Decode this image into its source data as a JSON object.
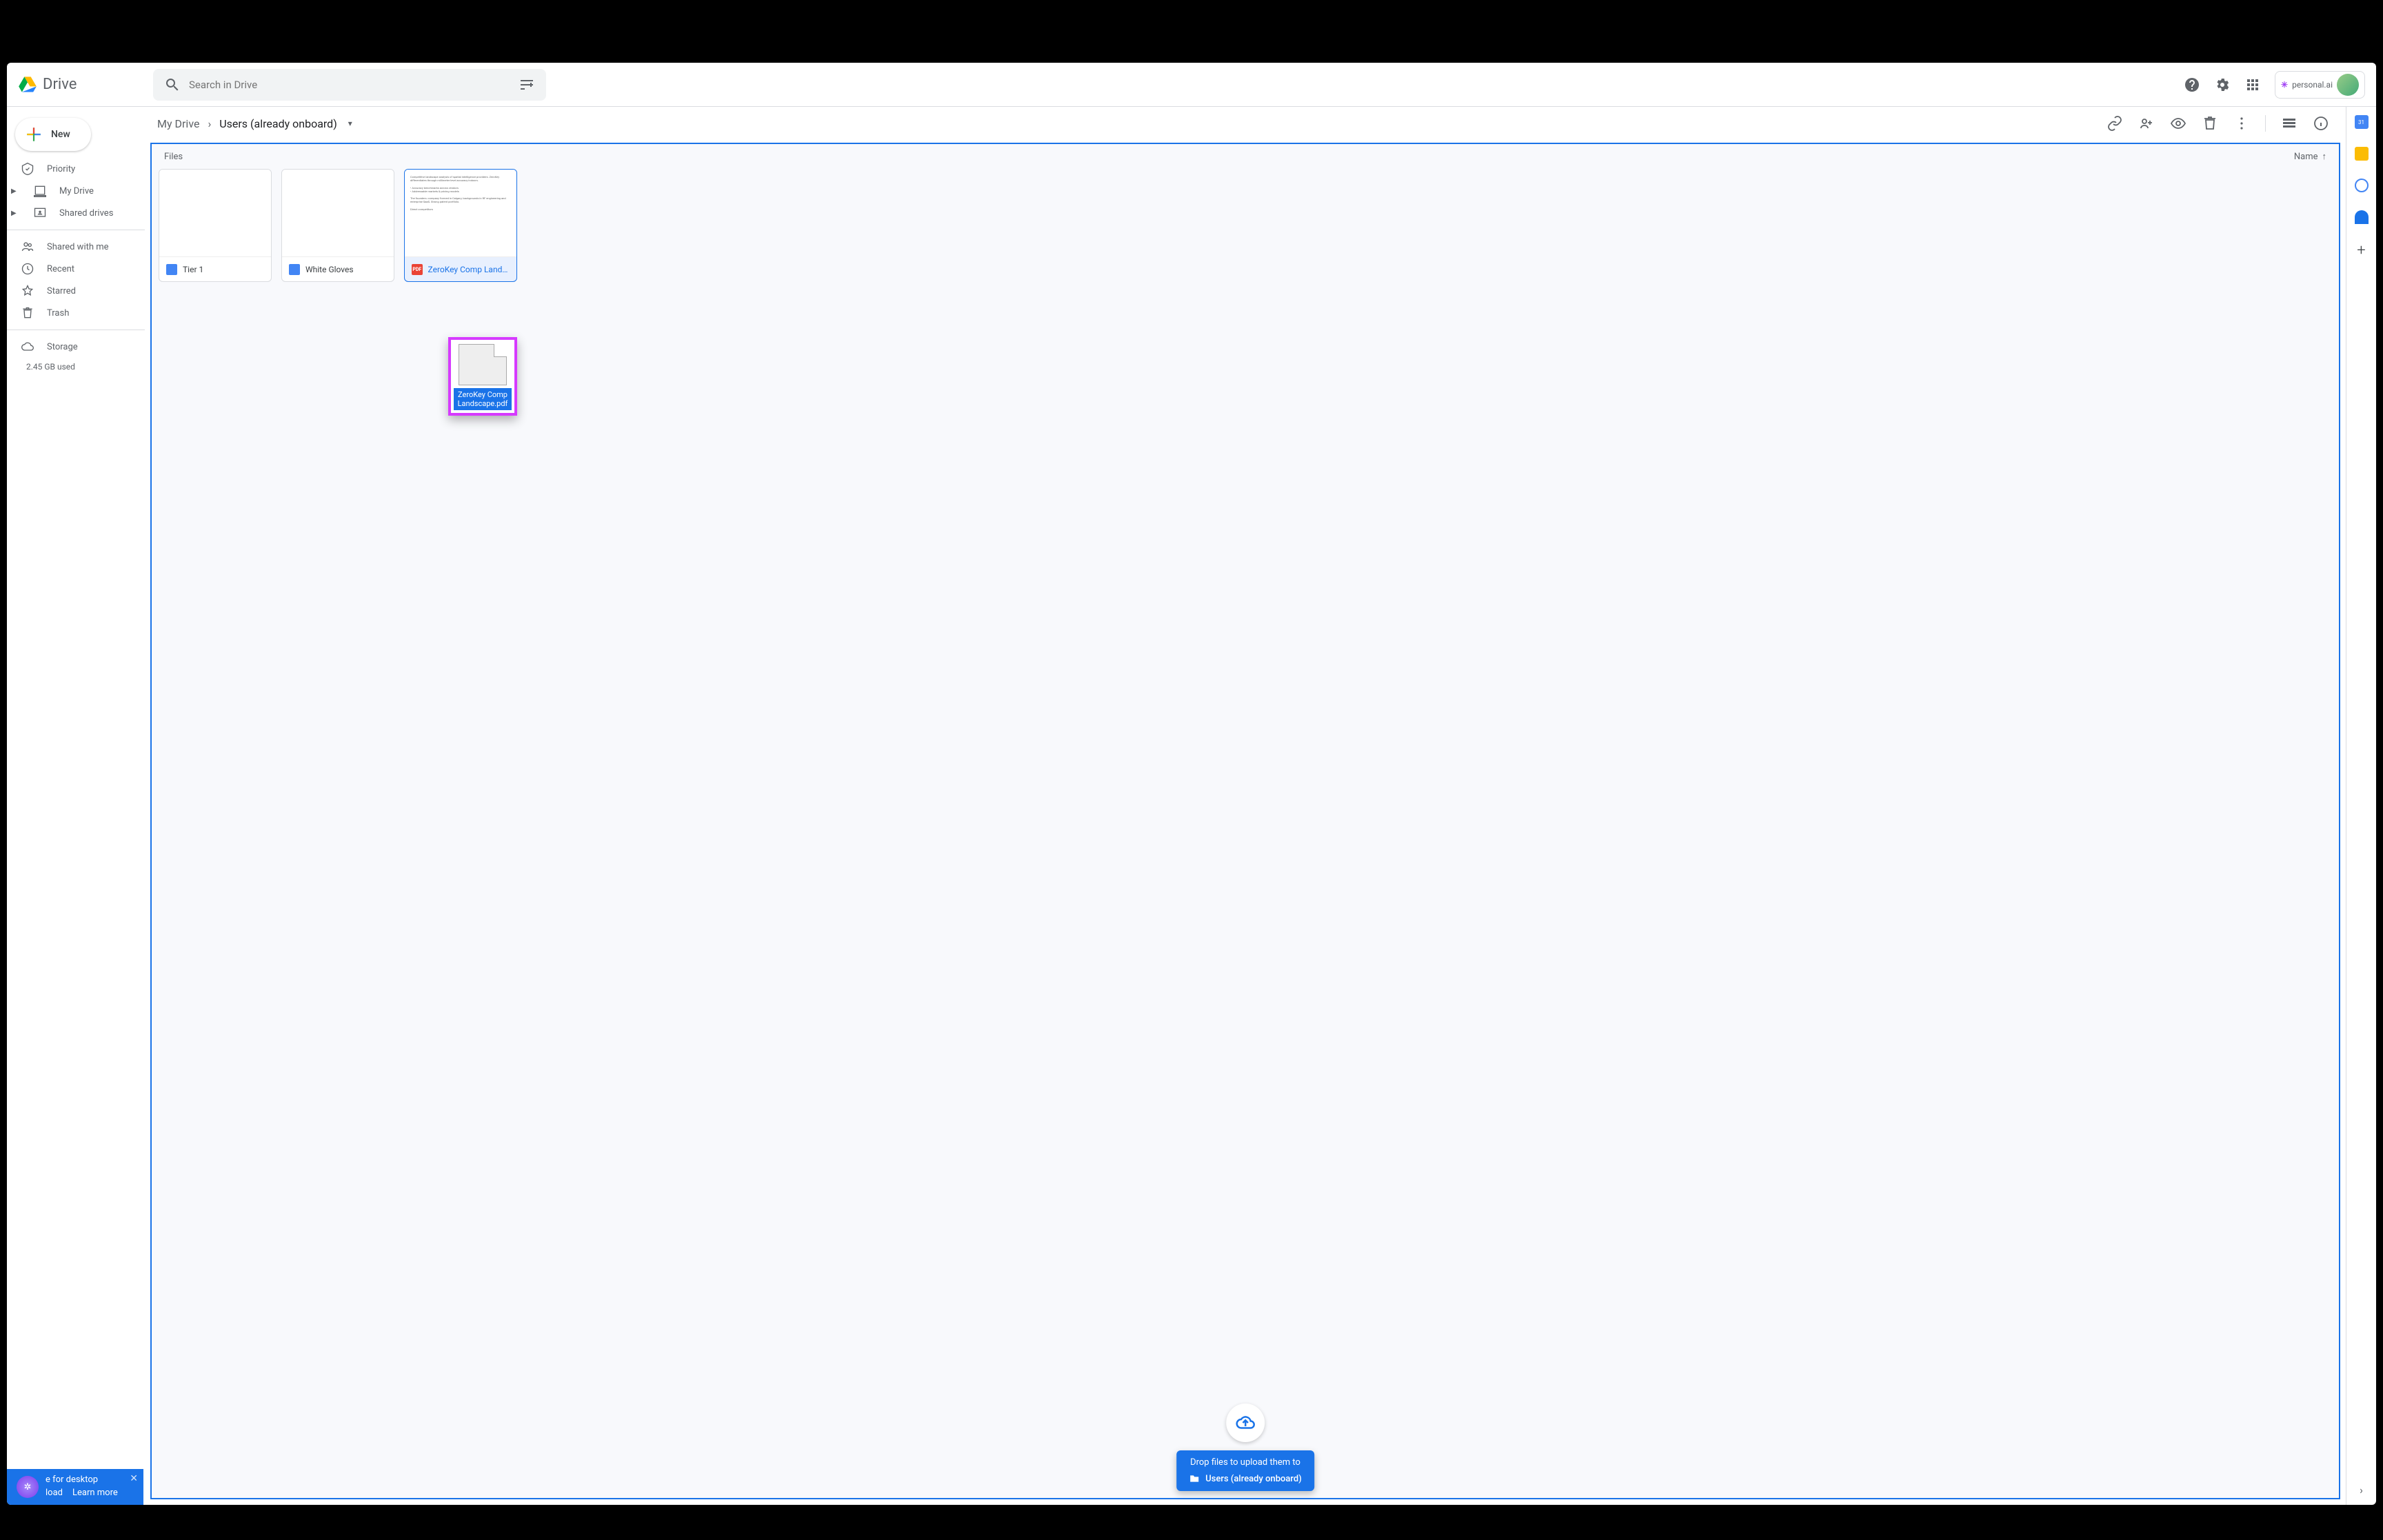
{
  "header": {
    "app_name": "Drive",
    "search_placeholder": "Search in Drive",
    "personal_chip": "personal.ai"
  },
  "sidebar": {
    "new_label": "New",
    "items": [
      {
        "label": "Priority"
      },
      {
        "label": "My Drive"
      },
      {
        "label": "Shared drives"
      },
      {
        "label": "Shared with me"
      },
      {
        "label": "Recent"
      },
      {
        "label": "Starred"
      },
      {
        "label": "Trash"
      },
      {
        "label": "Storage"
      }
    ],
    "storage_used": "2.45 GB used"
  },
  "breadcrumb": {
    "root": "My Drive",
    "current": "Users (already onboard)"
  },
  "toolbar": {},
  "content": {
    "section_label": "Files",
    "sort_label": "Name",
    "files": [
      {
        "name": "Tier 1",
        "type": "doc"
      },
      {
        "name": "White Gloves",
        "type": "doc"
      },
      {
        "name": "ZeroKey Comp Lands…",
        "type": "pdf",
        "pdf_badge": "PDF",
        "selected": true
      }
    ]
  },
  "drag_ghost": {
    "filename": "ZeroKey Comp Landscape.pdf"
  },
  "upload": {
    "hint": "Drop files to upload them to",
    "folder": "Users (already onboard)"
  },
  "toast": {
    "title_suffix": "e for desktop",
    "action1": "load",
    "action2": "Learn more"
  }
}
